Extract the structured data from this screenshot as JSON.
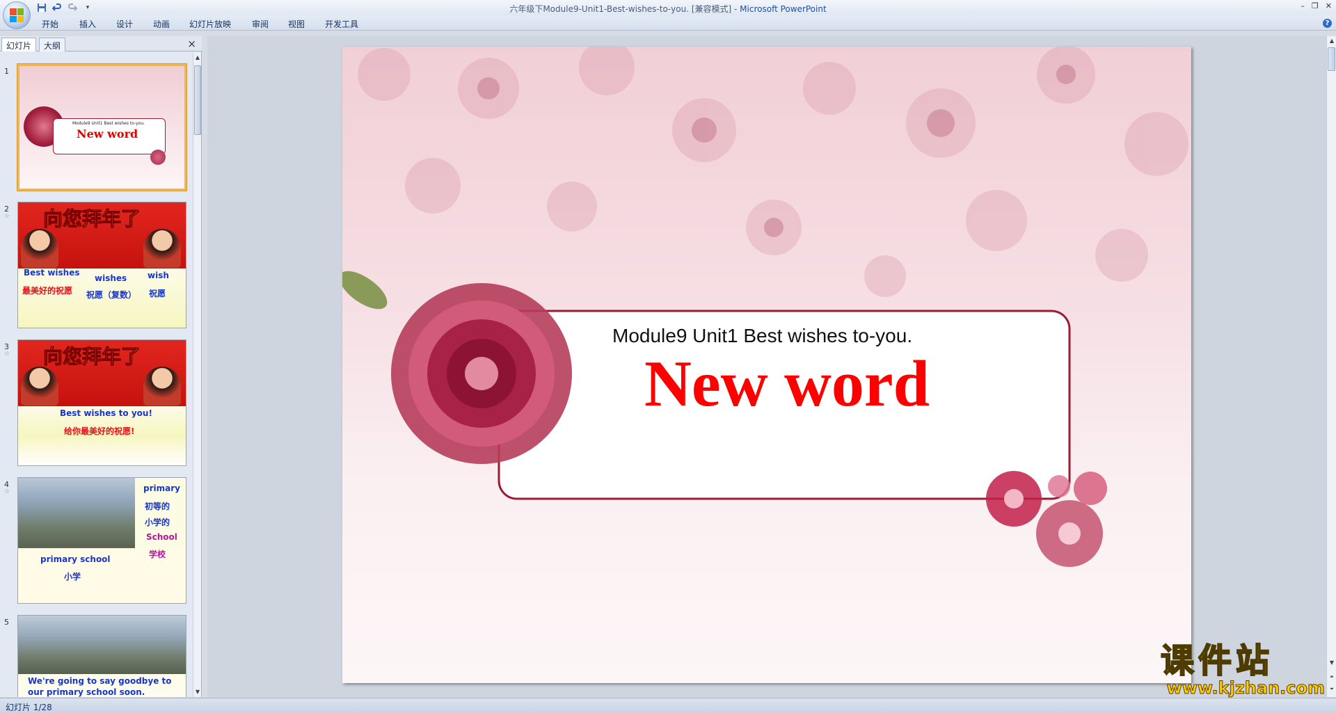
{
  "window": {
    "title": "六年级下Module9-Unit1-Best-wishes-to-you. [兼容模式]",
    "title_sep": " - ",
    "app_name": "Microsoft PowerPoint"
  },
  "quick_access": {
    "save": "save-icon",
    "undo": "undo-icon",
    "redo": "redo-icon",
    "customize": "▾"
  },
  "menu": [
    "开始",
    "插入",
    "设计",
    "动画",
    "幻灯片放映",
    "审阅",
    "视图",
    "开发工具"
  ],
  "panel": {
    "tabs": [
      "幻灯片",
      "大纲"
    ],
    "close": "×"
  },
  "thumbnails": [
    {
      "num": "1",
      "subtitle": "Module9 Unit1 Best wishes to-you.",
      "title": "New word"
    },
    {
      "num": "2",
      "banner": "向您拜年了",
      "lines": [
        "Best wishes",
        "最美好的祝愿",
        "wishes",
        "祝愿（复数）",
        "wish",
        "祝愿"
      ]
    },
    {
      "num": "3",
      "banner": "向您拜年了",
      "lines": [
        "Best wishes to you!",
        "给你最美好的祝愿!"
      ]
    },
    {
      "num": "4",
      "lines": [
        "primary",
        "初等的",
        "小学的",
        "School",
        "学校",
        "primary school",
        "小学"
      ]
    },
    {
      "num": "5",
      "lines": [
        "We're going to say goodbye to our primary school soon."
      ]
    }
  ],
  "slide": {
    "subtitle": "Module9 Unit1 Best wishes to-you.",
    "title": "New word",
    "colors": {
      "title": "#ff0000",
      "frame": "#9b1b35",
      "background": "#f3d6dc"
    }
  },
  "status": {
    "slide_info": "幻灯片 1/28"
  },
  "watermark": {
    "title": "课件站",
    "url": "www.kjzhan.com"
  }
}
